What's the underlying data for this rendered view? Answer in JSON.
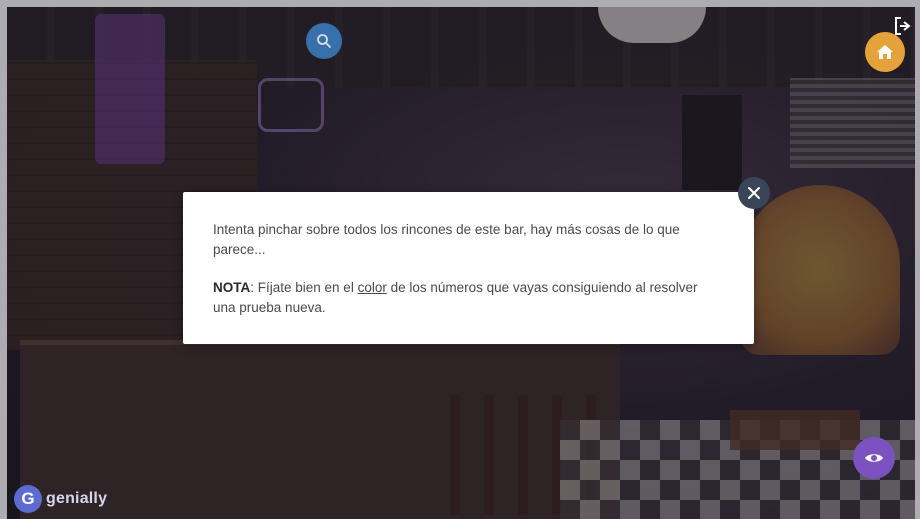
{
  "modal": {
    "line1": "Intenta pinchar sobre todos los rincones de este bar, hay más cosas de lo que parece...",
    "note_label": "NOTA",
    "note_before": ": Fíjate bien en el ",
    "note_link": "color",
    "note_after": " de los números que vayas consiguiendo al resolver una prueba nueva."
  },
  "buttons": {
    "close": "close-icon",
    "search": "search-icon",
    "home": "home-icon",
    "eye": "eye-icon",
    "exit": "exit-icon"
  },
  "brand": {
    "name": "genially",
    "logo_letter": "G"
  },
  "colors": {
    "search": "#3c7fc4",
    "home": "#e5a23a",
    "eye": "#7b52c0",
    "close": "#3a4658",
    "modal_bg": "#ffffff",
    "brand": "#5b6bd0"
  }
}
